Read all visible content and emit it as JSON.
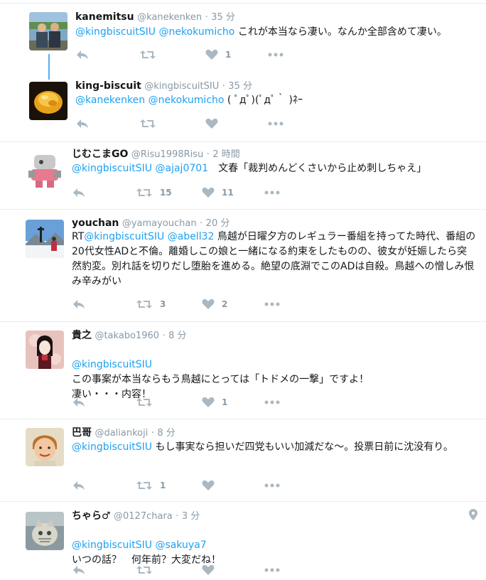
{
  "tweets": [
    {
      "name": "kanemitsu",
      "handle": "@kanekenken",
      "time": "35 分",
      "segments": [
        {
          "text": "@kingbiscuitSIU",
          "mention": true
        },
        {
          "text": " ",
          "mention": false
        },
        {
          "text": "@nekokumicho",
          "mention": true
        },
        {
          "text": " これが本当なら凄い。なんか全部含めて凄い。",
          "mention": false
        }
      ],
      "retweets": "",
      "likes": "1"
    },
    {
      "name": "king-biscuit",
      "handle": "@kingbiscuitSIU",
      "time": "35 分",
      "segments": [
        {
          "text": "@kanekenken",
          "mention": true
        },
        {
          "text": " ",
          "mention": false
        },
        {
          "text": "@nekokumicho",
          "mention": true
        },
        {
          "text": " ( ﾟдﾟ)(ﾟдﾟ｀ )ﾈｰ",
          "mention": false
        }
      ],
      "retweets": "",
      "likes": ""
    },
    {
      "name": "じむこまGO",
      "handle": "@Risu1998Risu",
      "time": "2 時間",
      "segments": [
        {
          "text": "@kingbiscuitSIU",
          "mention": true
        },
        {
          "text": " ",
          "mention": false
        },
        {
          "text": "@ajaj0701",
          "mention": true
        },
        {
          "text": "　文春「裁判めんどくさいから止め刺しちゃえ」",
          "mention": false
        }
      ],
      "retweets": "15",
      "likes": "11"
    },
    {
      "name": "youchan",
      "handle": "@yamayouchan",
      "time": "20 分",
      "segments": [
        {
          "text": "RT",
          "mention": false
        },
        {
          "text": "@kingbiscuitSIU",
          "mention": true
        },
        {
          "text": " ",
          "mention": false
        },
        {
          "text": "@abell32",
          "mention": true
        },
        {
          "text": " 鳥越が日曜夕方のレギュラー番組を持ってた時代、番組の20代女性ADと不倫。離婚しこの娘と一緒になる約束をしたものの、彼女が妊娠したら突然豹変。別れ話を切りだし堕胎を進める。絶望の底淵でこのADは自殺。鳥越への憎しみ恨み辛みがい",
          "mention": false
        }
      ],
      "retweets": "3",
      "likes": "2"
    },
    {
      "name": "貴之",
      "handle": "@takabo1960",
      "time": "8 分",
      "segments": [
        {
          "text": "@kingbiscuitSIU",
          "mention": true
        },
        {
          "text": "\nこの事案が本当ならもう鳥越にとっては「トドメの一撃」ですよ！\n凄い・・・内容！",
          "mention": false
        }
      ],
      "retweets": "",
      "likes": "1"
    },
    {
      "name": "巴哥",
      "handle": "@daliankoji",
      "time": "8 分",
      "segments": [
        {
          "text": "@kingbiscuitSIU",
          "mention": true
        },
        {
          "text": " もし事実なら担いだ四党もいい加減だな〜。投票日前に沈没有り。",
          "mention": false
        }
      ],
      "retweets": "1",
      "likes": ""
    },
    {
      "name": "ちゃら♂",
      "handle": "@0127chara",
      "time": "3 分",
      "segments": [
        {
          "text": "@kingbiscuitSIU",
          "mention": true
        },
        {
          "text": " ",
          "mention": false
        },
        {
          "text": "@sakuya7",
          "mention": true
        },
        {
          "text": "\nいつの話？　何年前？大変だね！",
          "mention": false
        }
      ],
      "retweets": "",
      "likes": ""
    }
  ],
  "icons": {
    "reply": "reply-icon",
    "retweet": "retweet-icon",
    "like": "heart-icon",
    "more": "more-icon",
    "location": "location-pin-icon"
  },
  "colors": {
    "mention": "#1da1f2",
    "icon": "#aab8c2",
    "meta": "#8899a6",
    "thread": "#55acee"
  }
}
